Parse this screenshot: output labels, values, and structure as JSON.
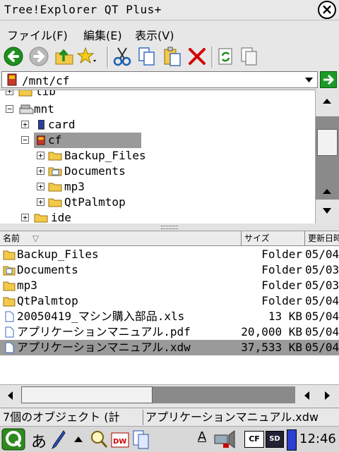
{
  "window": {
    "title": "Tree!Explorer QT Plus+"
  },
  "menu": {
    "items": [
      "ファイル(F)",
      "編集(E)",
      "表示(V)"
    ]
  },
  "toolbar": {
    "icons": [
      "back-icon",
      "forward-icon",
      "up-folder-icon",
      "favorites-icon",
      "cut-icon",
      "copy-icon",
      "paste-icon",
      "delete-icon",
      "refresh-icon",
      "properties-icon"
    ],
    "colors": {
      "back": "#1e8f1e",
      "forward": "#b8b8b8",
      "delete": "#d40000"
    }
  },
  "path": {
    "value": "/mnt/cf"
  },
  "tree": {
    "rows": [
      {
        "label": "lib",
        "expander": "+"
      },
      {
        "label": "mnt",
        "expander": "−"
      },
      {
        "label": "card",
        "expander": "+"
      },
      {
        "label": "cf",
        "expander": "−",
        "selected": true
      },
      {
        "label": "Backup_Files",
        "expander": "+"
      },
      {
        "label": "Documents",
        "expander": "+"
      },
      {
        "label": "mp3",
        "expander": "+"
      },
      {
        "label": "QtPalmtop",
        "expander": "+"
      },
      {
        "label": "ide",
        "expander": "+"
      }
    ]
  },
  "list": {
    "columns": [
      "名前",
      "サイズ",
      "更新日時"
    ],
    "sort_indicator": "▽",
    "rows": [
      {
        "name": "Backup_Files",
        "size": "Folder",
        "date": "05/04"
      },
      {
        "name": "Documents",
        "size": "Folder",
        "date": "05/03"
      },
      {
        "name": "mp3",
        "size": "Folder",
        "date": "05/03"
      },
      {
        "name": "QtPalmtop",
        "size": "Folder",
        "date": "05/04"
      },
      {
        "name": "20050419_マシン購入部品.xls",
        "size": "13 KB",
        "date": "05/04"
      },
      {
        "name": "アプリケーションマニュアル.pdf",
        "size": "20,000 KB",
        "date": "05/04"
      },
      {
        "name": "アプリケーションマニュアル.xdw",
        "size": "37,533 KB",
        "date": "05/04",
        "selected": true
      }
    ]
  },
  "status": {
    "left": "7個のオブジェクト (計",
    "right": "アプリケーションマニュアル.xdw"
  },
  "taskbar": {
    "input_mode": "あ",
    "clock": "12:46",
    "cf_label": "CF",
    "sd_label": "SD",
    "a_label": "A"
  }
}
